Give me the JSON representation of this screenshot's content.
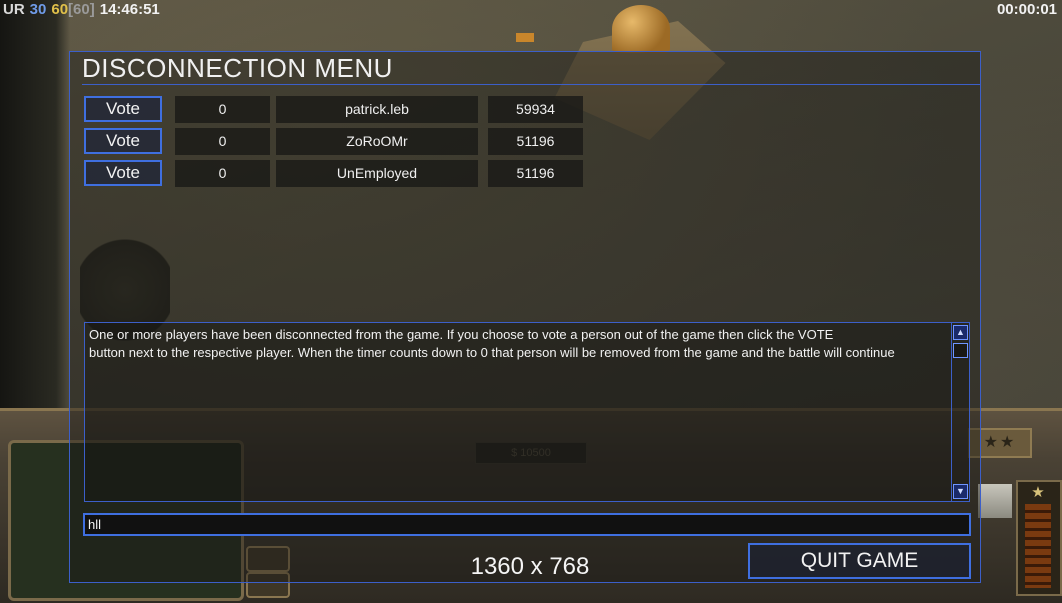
{
  "status": {
    "ur": "UR",
    "fps": "30",
    "fps_target": "60",
    "fps_max": "[60]",
    "clock": "14:46:51",
    "elapsed": "00:00:01"
  },
  "background": {
    "money": "$ 10500"
  },
  "dialog": {
    "title": "DISCONNECTION MENU",
    "players": [
      {
        "vote_label": "Vote",
        "votes": "0",
        "name": "patrick.leb",
        "timer": "59934"
      },
      {
        "vote_label": "Vote",
        "votes": "0",
        "name": "ZoRoOMr",
        "timer": "51196"
      },
      {
        "vote_label": "Vote",
        "votes": "0",
        "name": "UnEmployed",
        "timer": "51196"
      }
    ],
    "message": "One or more players have been disconnected from the game. If you choose to vote a person out of the game then click the VOTE\n button next to the respective player. When the timer counts down to 0 that person will be removed from the game and the battle will continue",
    "chat_value": "hll",
    "resolution": "1360 x 768",
    "quit_label": "QUIT GAME"
  },
  "icons": {
    "scroll_up": "scroll-up-icon",
    "scroll_down": "scroll-down-icon",
    "rank_star": "star-icon"
  },
  "colors": {
    "accent": "#3f6fe0",
    "fps": "#6f9be8",
    "fps_target": "#e0c04a"
  }
}
